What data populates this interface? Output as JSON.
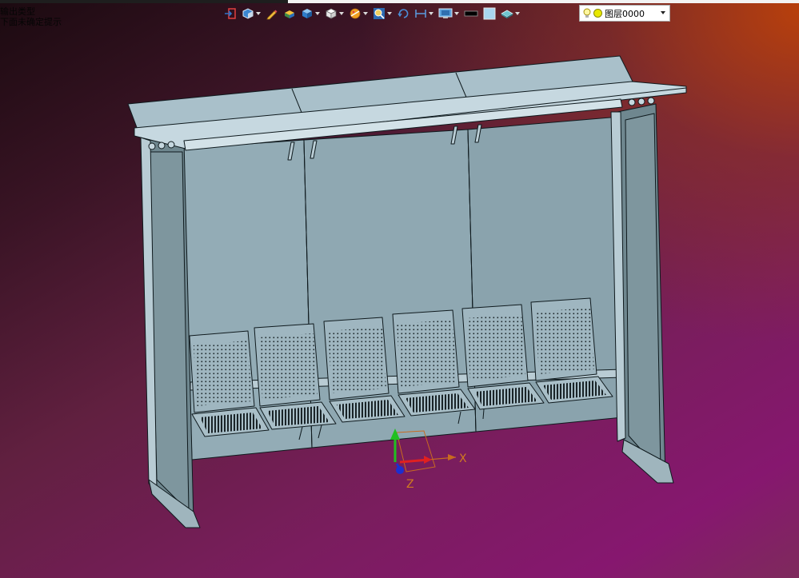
{
  "status": {
    "line1": "输出类型",
    "line2": "下面未确定提示"
  },
  "toolbar": {
    "buttons": [
      {
        "name": "exit-sketch-button",
        "icon": "exit-icon",
        "has_dropdown": false
      },
      {
        "name": "view-orient-button",
        "icon": "view-cube-icon",
        "has_dropdown": true
      },
      {
        "name": "pencil-button",
        "icon": "pencil-icon",
        "has_dropdown": false
      },
      {
        "name": "shade-button",
        "icon": "shaded-box-icon",
        "has_dropdown": false
      },
      {
        "name": "render-style-button",
        "icon": "blue-cube-icon",
        "has_dropdown": true
      },
      {
        "name": "wireframe-button",
        "icon": "white-cube-icon",
        "has_dropdown": true
      },
      {
        "name": "section-button",
        "icon": "section-icon",
        "has_dropdown": true
      },
      {
        "name": "zoom-button",
        "icon": "zoom-icon",
        "has_dropdown": true
      },
      {
        "name": "rotate-button",
        "icon": "rotate-icon",
        "has_dropdown": false
      },
      {
        "name": "measure-button",
        "icon": "measure-icon",
        "has_dropdown": true
      },
      {
        "name": "display-button",
        "icon": "monitor-icon",
        "has_dropdown": true
      },
      {
        "name": "line-color-button",
        "icon": "black-swatch-icon",
        "has_dropdown": false
      },
      {
        "name": "fill-color-button",
        "icon": "blue-swatch-icon",
        "has_dropdown": false
      },
      {
        "name": "layer-style-button",
        "icon": "layer-icon",
        "has_dropdown": true
      }
    ],
    "colors": {
      "accent": "#2f74c8",
      "caret": "#d9d9d9"
    }
  },
  "layer": {
    "label": "图层0000",
    "icons": [
      "bulb-icon",
      "layer-dot-icon"
    ],
    "dot_color": "#e8e800"
  },
  "triad": {
    "x_label": "X",
    "z_label": "Z",
    "colors": {
      "x": "#e02020",
      "y": "#20c020",
      "z": "#1d2fd0",
      "label": "#d07a20"
    }
  },
  "model": {
    "name": "bus shelter",
    "seat_count": 6,
    "colors": {
      "body": "#8ba3ad",
      "panel": "#93acb6",
      "edge": "#0f1a1e",
      "light": "#c6d8e0",
      "dark": "#6f878f"
    }
  }
}
